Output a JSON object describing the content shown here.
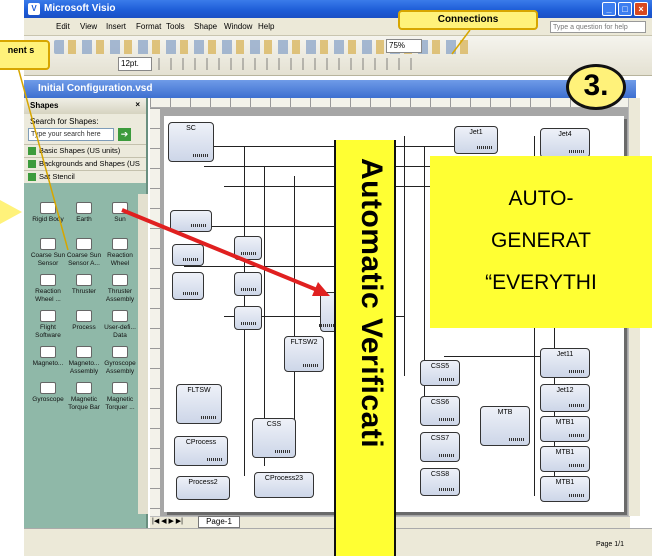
{
  "window": {
    "title": "Microsoft Visio"
  },
  "menu": {
    "items": [
      "Edit",
      "View",
      "Insert",
      "Format",
      "Tools",
      "Shape",
      "Window",
      "Help"
    ],
    "help_placeholder": "Type a question for help"
  },
  "toolbar": {
    "zoom": "75%",
    "font_size": "12pt."
  },
  "document": {
    "title": "Initial Configuration.vsd"
  },
  "shapes_pane": {
    "title": "Shapes",
    "search_label": "Search for Shapes:",
    "search_placeholder": "Type your search here",
    "stencils": [
      "Basic Shapes (US units)",
      "Backgrounds and Shapes (US units)",
      "Sat Stencil"
    ],
    "items": [
      {
        "label": "Rigid Body"
      },
      {
        "label": "Earth"
      },
      {
        "label": "Sun"
      },
      {
        "label": "Coarse Sun Sensor"
      },
      {
        "label": "Coarse Sun Sensor A..."
      },
      {
        "label": "Reaction Wheel"
      },
      {
        "label": "Reaction Wheel ..."
      },
      {
        "label": "Thruster"
      },
      {
        "label": "Thruster Assembly"
      },
      {
        "label": "Flight Software"
      },
      {
        "label": "Process"
      },
      {
        "label": "User-defi... Data"
      },
      {
        "label": "Magneto..."
      },
      {
        "label": "Magneto... Assembly"
      },
      {
        "label": "Gyroscope Assembly"
      },
      {
        "label": "Gyroscope"
      },
      {
        "label": "Magnetic Torque Bar"
      },
      {
        "label": "Magnetic Torquer ..."
      }
    ]
  },
  "diagram": {
    "blocks": {
      "sc": "SC",
      "fltsw2": "FLTSW2",
      "fltsw": "FLTSW",
      "css": "CSS",
      "cprocess": "CProcess",
      "process2": "Process2",
      "cprocess23": "CProcess23",
      "css5": "CSS5",
      "css6": "CSS6",
      "css7": "CSS7",
      "css8": "CSS8",
      "mtb": "MTB",
      "jet1": "Jet1",
      "jet4": "Jet4",
      "jet11": "Jet11",
      "jet12": "Jet12",
      "mtb1a": "MTB1",
      "mtb1b": "MTB1",
      "mtb1c": "MTB1"
    }
  },
  "page_tab": "Page-1",
  "status": {
    "page": "Page 1/1"
  },
  "callouts": {
    "connections": "Connections",
    "component": "nent s",
    "step": "3.",
    "auto": [
      "AUTO-",
      "GENERAT",
      "“EVERYTHI"
    ],
    "verification": "Automatic Verificati"
  },
  "colors": {
    "callout": "#fff27a",
    "highlight": "#ffff33",
    "arrow": "#e02020",
    "titlebar": "#1c5bd6"
  }
}
